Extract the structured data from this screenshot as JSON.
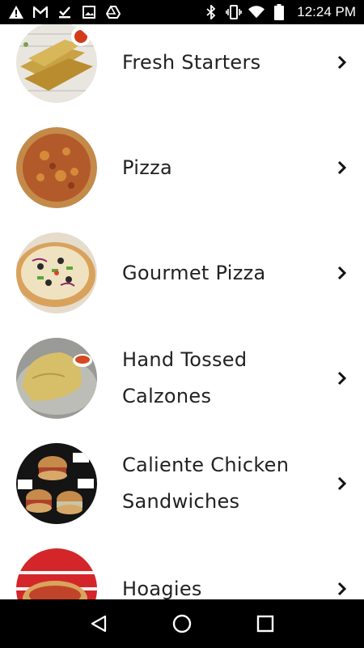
{
  "status_bar": {
    "time": "12:24 PM",
    "left_icons": [
      "warning-icon",
      "gmail-icon",
      "download-done-icon",
      "image-icon",
      "drive-icon"
    ],
    "right_icons": [
      "bluetooth-icon",
      "vibrate-icon",
      "wifi-icon",
      "battery-icon"
    ]
  },
  "menu": {
    "items": [
      {
        "label": "Fresh Starters",
        "image": "breadsticks-thumbnail"
      },
      {
        "label": "Pizza",
        "image": "pizza-thumbnail"
      },
      {
        "label": "Gourmet Pizza",
        "image": "gourmet-pizza-thumbnail"
      },
      {
        "label": "Hand Tossed Calzones",
        "image": "calzone-thumbnail"
      },
      {
        "label": "Caliente Chicken Sandwiches",
        "image": "chicken-sandwich-thumbnail"
      },
      {
        "label": "Hoagies",
        "image": "hoagie-thumbnail"
      }
    ]
  },
  "nav_bar": {
    "buttons": [
      "back-icon",
      "home-icon",
      "recents-icon"
    ]
  },
  "colors": {
    "status_bar_bg": "#000000",
    "nav_bar_bg": "#000000",
    "text": "#222222"
  }
}
